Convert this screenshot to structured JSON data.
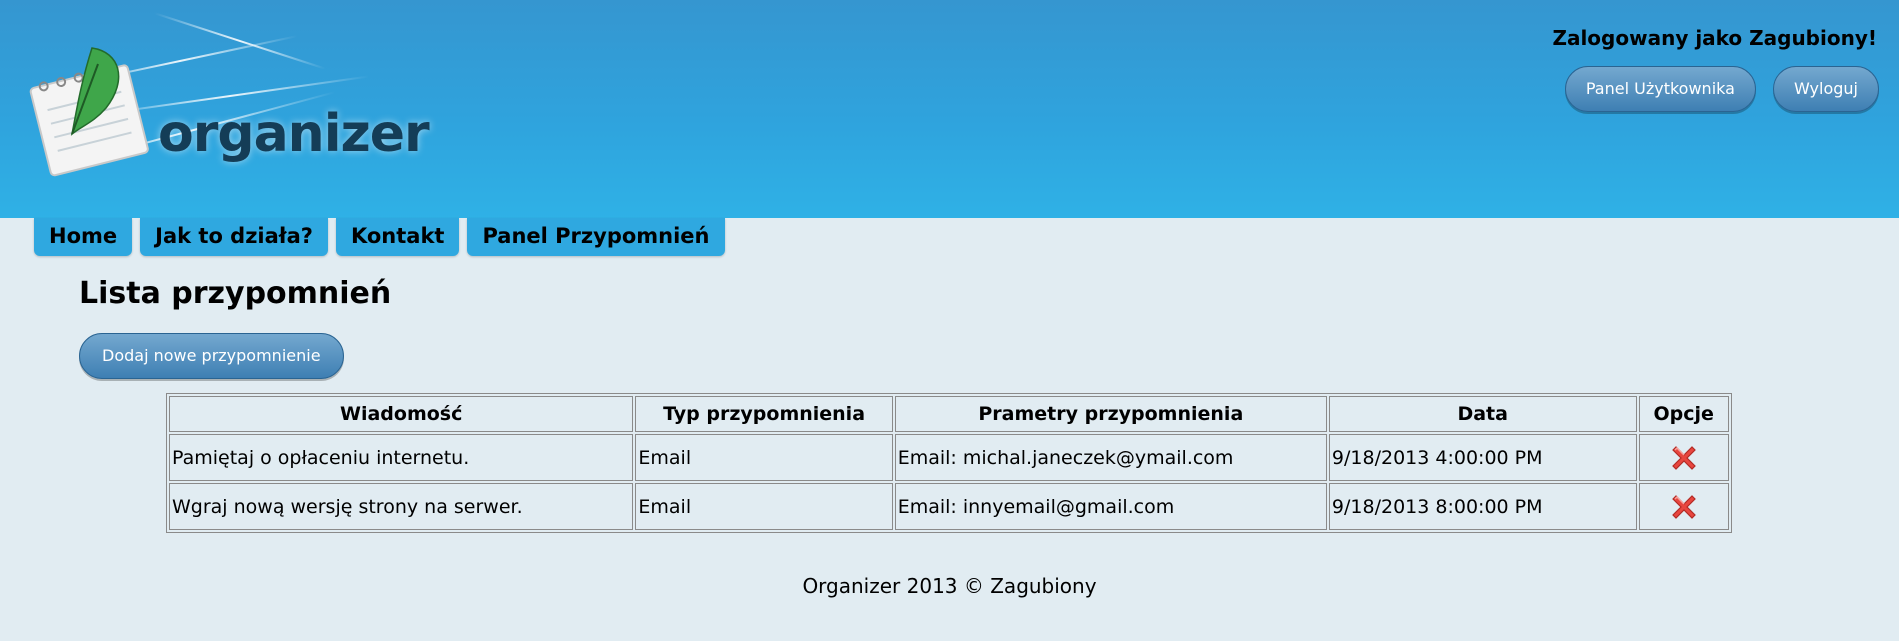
{
  "header": {
    "logo_text": "organizer",
    "logged_in_text": "Zalogowany jako Zagubiony!",
    "user_panel_label": "Panel Użytkownika",
    "logout_label": "Wyloguj"
  },
  "nav": {
    "tabs": [
      {
        "label": "Home"
      },
      {
        "label": "Jak to działa?"
      },
      {
        "label": "Kontakt"
      },
      {
        "label": "Panel Przypomnień"
      }
    ]
  },
  "main": {
    "title": "Lista przypomnień",
    "add_button_label": "Dodaj nowe przypomnienie",
    "table": {
      "columns": [
        "Wiadomość",
        "Typ przypomnienia",
        "Prametry przypomnienia",
        "Data",
        "Opcje"
      ],
      "rows": [
        {
          "message": "Pamiętaj o opłaceniu internetu.",
          "type": "Email",
          "params": "Email: michal.janeczek@ymail.com",
          "date": "9/18/2013 4:00:00 PM",
          "option_icon": "delete-x-icon"
        },
        {
          "message": "Wgraj nową wersję strony na serwer.",
          "type": "Email",
          "params": "Email: innyemail@gmail.com",
          "date": "9/18/2013 8:00:00 PM",
          "option_icon": "delete-x-icon"
        }
      ]
    }
  },
  "footer": {
    "text": "Organizer 2013 © Zagubiony"
  },
  "colors": {
    "header_blue": "#2fa3dd",
    "tab_blue": "#2fa8e0",
    "button_blue": "#4f8ec0",
    "page_bg": "#e1ecf2",
    "delete_red": "#e8463f"
  }
}
